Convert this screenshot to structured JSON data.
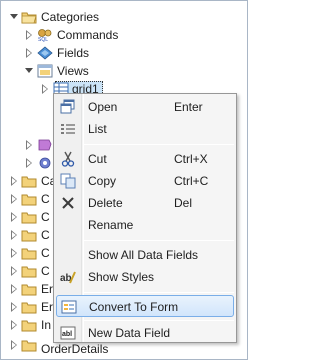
{
  "tree": {
    "root_label": "Categories",
    "commands_label": "Commands",
    "fields_label": "Fields",
    "views_label": "Views",
    "grid1_label": "grid1",
    "truncated_labels": [
      "Ca",
      "C",
      "C",
      "C",
      "C",
      "C",
      "Er",
      "Er",
      "In",
      "OrderDetails"
    ]
  },
  "menu": {
    "items": [
      {
        "label": "Open",
        "shortcut": "Enter",
        "icon": "open-window-icon"
      },
      {
        "label": "List",
        "shortcut": "",
        "icon": "list-icon"
      },
      {
        "label": "Cut",
        "shortcut": "Ctrl+X",
        "icon": "scissors-icon"
      },
      {
        "label": "Copy",
        "shortcut": "Ctrl+C",
        "icon": "copy-icon"
      },
      {
        "label": "Delete",
        "shortcut": "Del",
        "icon": "delete-x-icon"
      },
      {
        "label": "Rename",
        "shortcut": "",
        "icon": ""
      },
      {
        "label": "Show All Data Fields",
        "shortcut": "",
        "icon": ""
      },
      {
        "label": "Show Styles",
        "shortcut": "",
        "icon": "styles-icon"
      },
      {
        "label": "Convert To Form",
        "shortcut": "",
        "icon": "form-icon"
      },
      {
        "label": "New Data Field",
        "shortcut": "",
        "icon": "data-field-icon"
      }
    ]
  },
  "colors": {
    "highlight_border": "#7aaee8",
    "folder_yellow": "#f3d27a",
    "selection_bg": "#cce4f7"
  }
}
